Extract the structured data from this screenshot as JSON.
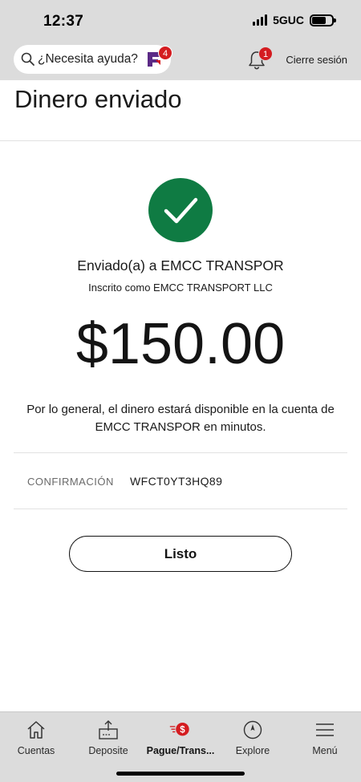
{
  "status_bar": {
    "time": "12:37",
    "network": "5GUC",
    "signal_bars": 4,
    "battery_level": 0.72
  },
  "header": {
    "help_text": "¿Necesita ayuda?",
    "assistant_badge": "4",
    "notifications_badge": "1",
    "logout_label": "Cierre sesión",
    "icons": [
      "search-icon",
      "assistant-logo-icon",
      "bell-icon"
    ]
  },
  "page": {
    "title": "Dinero enviado"
  },
  "confirmation": {
    "sent_to": "Enviado(a) a EMCC TRANSPOR",
    "enrolled_as": "Inscrito como EMCC TRANSPORT LLC",
    "amount": "$150.00",
    "notice": "Por lo general, el dinero estará disponible en la cuenta de EMCC TRANSPOR en minutos.",
    "confirmation_label": "CONFIRMACIÓN",
    "confirmation_number": "WFCT0YT3HQ89",
    "done_label": "Listo"
  },
  "nav": {
    "items": [
      {
        "label": "Cuentas",
        "icon": "home-icon"
      },
      {
        "label": "Deposite",
        "icon": "deposit-icon"
      },
      {
        "label": "Pague/Trans...",
        "icon": "pay-transfer-icon",
        "active": true
      },
      {
        "label": "Explore",
        "icon": "compass-icon"
      },
      {
        "label": "Menú",
        "icon": "menu-icon"
      }
    ]
  },
  "colors": {
    "header_bg": "#dcdcdc",
    "success_green": "#0f7b43",
    "badge_red": "#d41c20",
    "assistant_purple": "#5b2a86"
  }
}
